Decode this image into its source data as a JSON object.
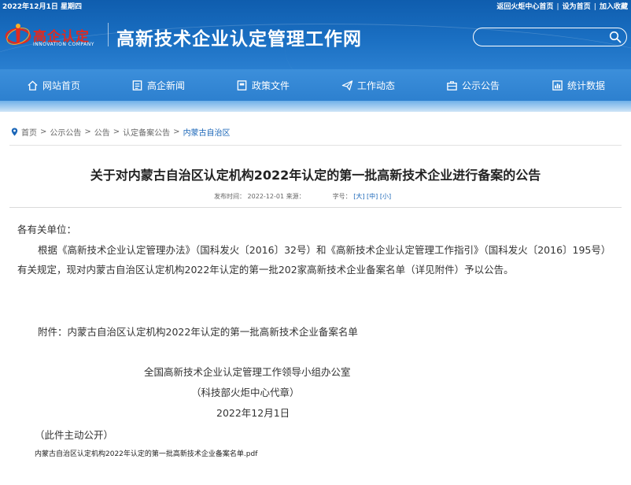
{
  "topbar": {
    "date": "2022年12月1日 星期四",
    "links": [
      "返回火炬中心首页",
      "设为首页",
      "加入收藏"
    ]
  },
  "logo": {
    "cn": "高企认定",
    "en": "INNOVATION COMPANY"
  },
  "site_title": "高新技术企业认定管理工作网",
  "search": {
    "placeholder": "",
    "icon": "search-icon"
  },
  "nav": [
    {
      "label": "网站首页",
      "icon": "home-icon"
    },
    {
      "label": "高企新闻",
      "icon": "news-icon"
    },
    {
      "label": "政策文件",
      "icon": "folder-icon"
    },
    {
      "label": "工作动态",
      "icon": "paper-plane-icon"
    },
    {
      "label": "公示公告",
      "icon": "briefcase-icon"
    },
    {
      "label": "统计数据",
      "icon": "chart-icon"
    }
  ],
  "breadcrumb": [
    "首页",
    "公示公告",
    "公告",
    "认定备案公告",
    "内蒙古自治区"
  ],
  "article": {
    "title": "关于对内蒙古自治区认定机构2022年认定的第一批高新技术企业进行备案的公告",
    "meta": {
      "published_label": "发布时间：",
      "published": "2022-12-01",
      "source_label": "来源：",
      "font_label": "字号：",
      "font_sizes": [
        "[大]",
        "[中]",
        "[小]"
      ]
    },
    "salutation": "各有关单位：",
    "paragraph": "根据《高新技术企业认定管理办法》（国科发火〔2016〕32号）和《高新技术企业认定管理工作指引》（国科发火〔2016〕195号）有关规定，现对内蒙古自治区认定机构2022年认定的第一批202家高新技术企业备案名单（详见附件）予以公告。",
    "attachment_line": "附件：内蒙古自治区认定机构2022年认定的第一批高新技术企业备案名单",
    "signature": [
      "全国高新技术企业认定管理工作领导小组办公室",
      "（科技部火炬中心代章）",
      "2022年12月1日"
    ],
    "disclosure": "（此件主动公开）",
    "attachment_file": "内蒙古自治区认定机构2022年认定的第一批高新技术企业备案名单.pdf"
  },
  "colors": {
    "header_blue": "#1a6fc2",
    "nav_blue": "#3587d6",
    "link_blue": "#1a66b8",
    "logo_red": "#e02a20"
  }
}
